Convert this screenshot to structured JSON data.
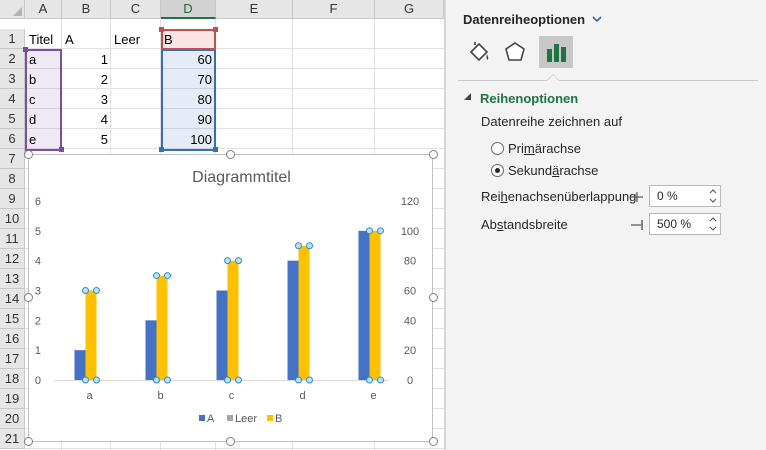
{
  "sheet": {
    "columns": [
      "A",
      "B",
      "C",
      "D",
      "E",
      "F",
      "G"
    ],
    "rows": [
      "1",
      "2",
      "3",
      "4",
      "5",
      "6",
      "7",
      "8",
      "9",
      "10",
      "11",
      "12",
      "13",
      "14",
      "15",
      "16",
      "17",
      "18",
      "19",
      "20",
      "21"
    ],
    "cells": {
      "a1": "Titel",
      "b1": "A",
      "c1": "Leer",
      "d1": "B",
      "a2": "a",
      "b2": "1",
      "d2": "60",
      "a3": "b",
      "b3": "2",
      "d3": "70",
      "a4": "c",
      "b4": "3",
      "d4": "80",
      "a5": "d",
      "b5": "4",
      "d5": "90",
      "a6": "e",
      "b6": "5",
      "d6": "100"
    }
  },
  "chart_data": {
    "type": "bar",
    "title": "Diagrammtitel",
    "categories": [
      "a",
      "b",
      "c",
      "d",
      "e"
    ],
    "series": [
      {
        "name": "A",
        "values": [
          1,
          2,
          3,
          4,
          5
        ],
        "axis": "primary",
        "color": "#4472c4"
      },
      {
        "name": "Leer",
        "values": [
          null,
          null,
          null,
          null,
          null
        ],
        "axis": "primary",
        "color": "#a5a5a5"
      },
      {
        "name": "B",
        "values": [
          60,
          70,
          80,
          90,
          100
        ],
        "axis": "secondary",
        "color": "#ffc000"
      }
    ],
    "primary_ylim": [
      0,
      6
    ],
    "primary_ticks": [
      "0",
      "1",
      "2",
      "3",
      "4",
      "5",
      "6"
    ],
    "secondary_ylim": [
      0,
      120
    ],
    "secondary_ticks": [
      "0",
      "20",
      "40",
      "60",
      "80",
      "100",
      "120"
    ],
    "legend": [
      "A",
      "Leer",
      "B"
    ],
    "legend_position": "bottom",
    "grid": false,
    "selected_series": "B"
  },
  "pane": {
    "title": "Datenreiheoptionen",
    "icons": [
      "fill-line-icon",
      "effects-pentagon-icon",
      "series-options-bar-icon"
    ],
    "section_title": "Reihenoptionen",
    "plot_on_label": "Datenreihe zeichnen auf",
    "radio_primary_pre": "Pri",
    "radio_primary_u": "m",
    "radio_primary_post": "ärachse",
    "radio_secondary_pre": "Sekund",
    "radio_secondary_u": "ä",
    "radio_secondary_post": "rachse",
    "selected_axis": "secondary",
    "overlap_pre": "Rei",
    "overlap_u": "h",
    "overlap_post": "enachsenüberlappung",
    "overlap_value": "0 %",
    "gap_pre": "Ab",
    "gap_u": "s",
    "gap_post": "tandsbreite",
    "gap_value": "500 %"
  }
}
